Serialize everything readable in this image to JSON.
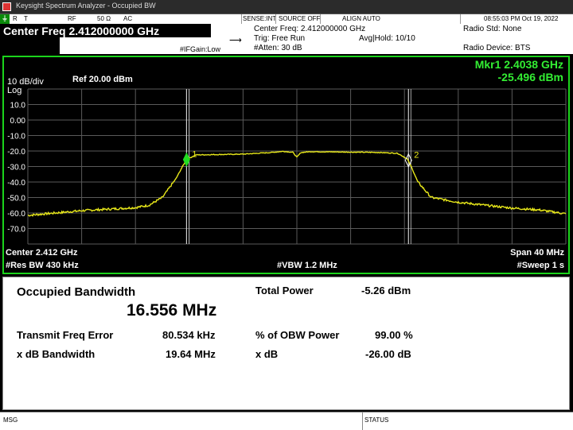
{
  "window": {
    "title": "Keysight Spectrum Analyzer - Occupied BW"
  },
  "strip": {
    "rt": "R",
    "t": "T",
    "rf": "RF",
    "impedance": "50 Ω",
    "coupling": "AC",
    "sense": "SENSE:INT",
    "source": "SOURCE OFF",
    "align": "ALIGN AUTO",
    "datetime": "08:55:03 PM Oct 19, 2022"
  },
  "header": {
    "center_freq_banner": "Center Freq 2.412000000 GHz",
    "center_freq_info": "Center Freq: 2.412000000 GHz",
    "trig": "Trig: Free Run",
    "avg_hold": "Avg|Hold: 10/10",
    "atten": "#Atten: 30 dB",
    "ifgain": "#IFGain:Low",
    "radio_std": "Radio Std: None",
    "radio_device": "Radio Device: BTS"
  },
  "graph": {
    "scale": "10 dB/div",
    "scale_type": "Log",
    "ref_level": "Ref 20.00 dBm",
    "marker_freq": "Mkr1  2.4038 GHz",
    "marker_amp": "-25.496 dBm",
    "marker1_label": "1",
    "marker2_label": "2",
    "y_ticks": [
      "10.0",
      "0.00",
      "-10.0",
      "-20.0",
      "-30.0",
      "-40.0",
      "-50.0",
      "-60.0",
      "-70.0"
    ],
    "center": "Center  2.412 GHz",
    "span": "Span 40 MHz",
    "res_bw": "#Res BW  430 kHz",
    "vbw": "#VBW  1.2 MHz",
    "sweep": "#Sweep  1 s",
    "colors": {
      "trace": "#e8e81a",
      "frame": "#1bd41b",
      "grid": "#5a5a5a",
      "marker": "#22dd22"
    }
  },
  "chart_data": {
    "type": "line",
    "xlabel": "",
    "ylabel": "",
    "xlim": [
      2392,
      2432
    ],
    "ylim": [
      -80,
      20
    ],
    "x_unit": "MHz",
    "y_unit": "dBm",
    "grid": true,
    "series": [
      {
        "values_x": [
          2392,
          2394,
          2396,
          2398,
          2400,
          2401,
          2402,
          2403,
          2403.5,
          2403.8,
          2404.5,
          2406,
          2408,
          2410,
          2411,
          2411.7,
          2412,
          2412.3,
          2413,
          2414,
          2416,
          2418,
          2419.5,
          2420.2,
          2420.5,
          2421,
          2422,
          2424,
          2426,
          2428,
          2430,
          2432
        ],
        "values_y": [
          -61.5,
          -60,
          -58.5,
          -57.5,
          -56.5,
          -55,
          -50,
          -38,
          -30,
          -25.5,
          -22.5,
          -22.3,
          -22,
          -21,
          -20.2,
          -20.8,
          -24,
          -21,
          -20.4,
          -20.5,
          -20.7,
          -20.9,
          -21.5,
          -25,
          -30,
          -40,
          -50,
          -53,
          -55,
          -56.8,
          -58,
          -60.5
        ]
      }
    ],
    "markers": [
      {
        "label": "1",
        "x": 2403.8,
        "y": -25.496
      },
      {
        "label": "2",
        "x": 2420.3,
        "y": -26.0
      }
    ],
    "obw_lines_x": [
      2403.8,
      2420.3
    ]
  },
  "measurement": {
    "title": "Occupied Bandwidth",
    "obw_value": "16.556 MHz",
    "tfe_label": "Transmit Freq Error",
    "tfe_value": "80.534 kHz",
    "xdb_bw_label": "x dB Bandwidth",
    "xdb_bw_value": "19.64 MHz",
    "total_power_label": "Total Power",
    "total_power_value": "-5.26 dBm",
    "obw_pct_label": "% of OBW Power",
    "obw_pct_value": "99.00 %",
    "xdb_label": "x dB",
    "xdb_value": "-26.00 dB"
  },
  "footer": {
    "msg": "MSG",
    "status": "STATUS"
  }
}
